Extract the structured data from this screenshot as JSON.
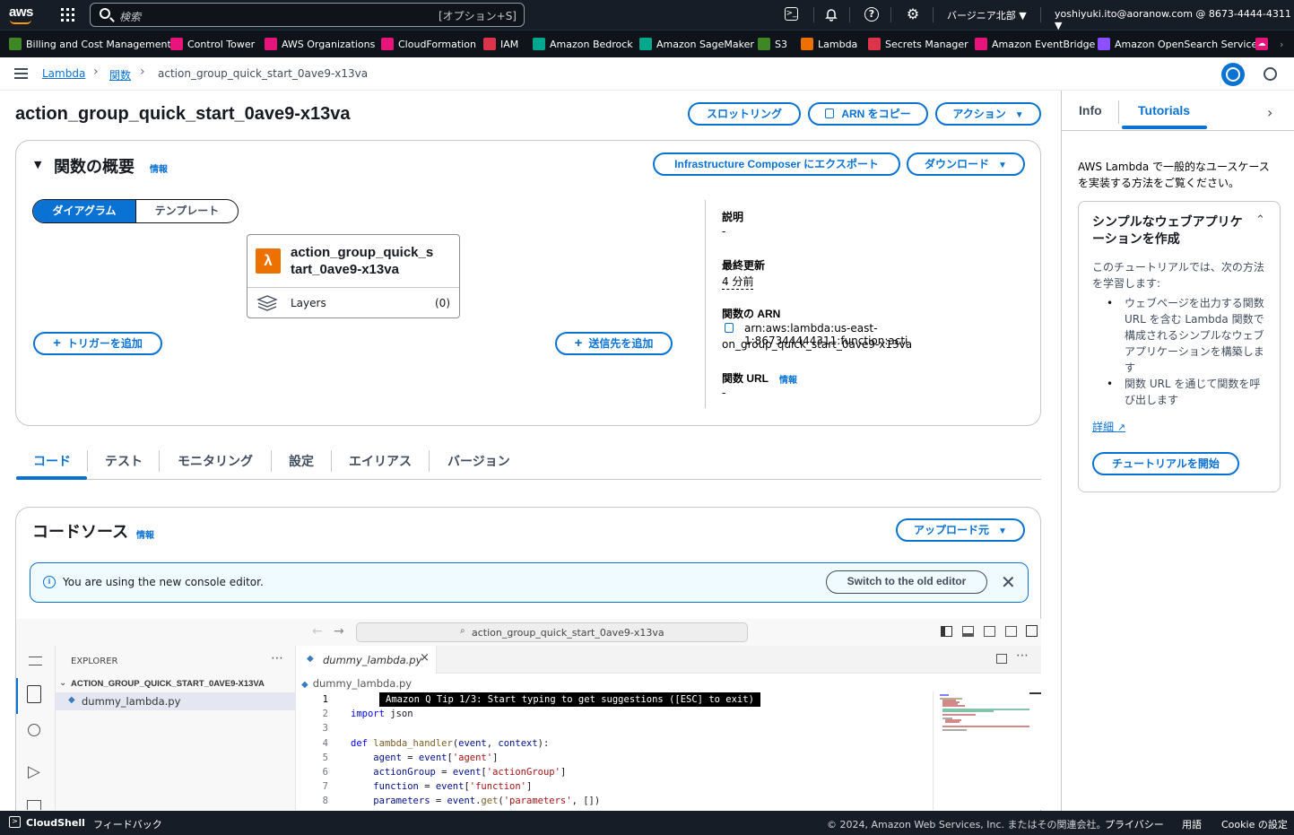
{
  "topnav": {
    "logo": "aws",
    "search_placeholder": "検索",
    "search_shortcut": "[オプション+S]",
    "region": "バージニア北部 ▼",
    "account": "yoshiyuki.ito@aoranow.com @ 8673-4444-4311 ▼"
  },
  "favorites": [
    {
      "label": "Billing and Cost Management",
      "color": "#3f8624"
    },
    {
      "label": "Control Tower",
      "color": "#e7157b"
    },
    {
      "label": "AWS Organizations",
      "color": "#e7157b"
    },
    {
      "label": "CloudFormation",
      "color": "#e7157b"
    },
    {
      "label": "IAM",
      "color": "#dd344c"
    },
    {
      "label": "Amazon Bedrock",
      "color": "#01a88d"
    },
    {
      "label": "Amazon SageMaker",
      "color": "#01a88d"
    },
    {
      "label": "S3",
      "color": "#3f8624"
    },
    {
      "label": "Lambda",
      "color": "#ed7100"
    },
    {
      "label": "Secrets Manager",
      "color": "#dd344c"
    },
    {
      "label": "Amazon EventBridge",
      "color": "#e7157b"
    },
    {
      "label": "Amazon OpenSearch Service",
      "color": "#8c4fff"
    }
  ],
  "breadcrumb": {
    "c1": "Lambda",
    "c2": "関数",
    "c3": "action_group_quick_start_0ave9-x13va",
    "sep": "›"
  },
  "header": {
    "title": "action_group_quick_start_0ave9-x13va",
    "throttle": "スロットリング",
    "copy_arn": "ARN をコピー",
    "actions": "アクション"
  },
  "overview": {
    "title": "関数の概要",
    "info": "情報",
    "export": "Infrastructure Composer にエクスポート",
    "download": "ダウンロード",
    "toggle_diagram": "ダイアグラム",
    "toggle_template": "テンプレート",
    "fn_name_line1": "action_group_quick_s",
    "fn_name_line2": "tart_0ave9-x13va",
    "layers_label": "Layers",
    "layers_count": "(0)",
    "add_trigger": "トリガーを追加",
    "add_destination": "送信先を追加",
    "desc_label": "説明",
    "desc_value": "-",
    "modified_label": "最終更新",
    "modified_value": "4 分前",
    "arn_label": "関数の ARN",
    "arn_line1": "arn:aws:lambda:us-east-1:867344444311:function:acti",
    "arn_line2": "on_group_quick_start_0ave9-x13va",
    "url_label": "関数 URL",
    "url_info": "情報",
    "url_value": "-"
  },
  "tabs": [
    "コード",
    "テスト",
    "モニタリング",
    "設定",
    "エイリアス",
    "バージョン"
  ],
  "code_source": {
    "title": "コードソース",
    "info": "情報",
    "upload": "アップロード元",
    "banner_text": "You are using the new console editor.",
    "banner_button": "Switch to the old editor"
  },
  "ide": {
    "search_text": "action_group_quick_start_0ave9-x13va",
    "explorer_label": "EXPLORER",
    "folder": "ACTION_GROUP_QUICK_START_0AVE9-X13VA",
    "file": "dummy_lambda.py",
    "tab_file": "dummy_lambda.py",
    "breadcrumb_file": "dummy_lambda.py",
    "tip": "Amazon Q Tip 1/3: Start typing to get suggestions ([ESC] to exit)",
    "line_numbers": [
      "1",
      "2",
      "3",
      "4",
      "5",
      "6",
      "7",
      "8"
    ]
  },
  "right_panel": {
    "tab_info": "Info",
    "tab_tutorials": "Tutorials",
    "intro": "AWS Lambda で一般的なユースケースを実装する方法をご覧ください。",
    "card_title": "シンプルなウェブアプリケーションを作成",
    "card_body": "このチュートリアルでは、次の方法を学習します:",
    "bullet1": "ウェブページを出力する関数 URL を含む Lambda 関数で構成されるシンプルなウェブアプリケーションを構築します",
    "bullet2": "関数 URL を通じて関数を呼び出します",
    "details": "詳細",
    "start": "チュートリアルを開始"
  },
  "footer": {
    "cloudshell": "CloudShell",
    "feedback": "フィードバック",
    "copyright": "© 2024, Amazon Web Services, Inc. またはその関連会社。",
    "privacy": "プライバシー",
    "terms": "用語",
    "cookie": "Cookie の設定"
  }
}
